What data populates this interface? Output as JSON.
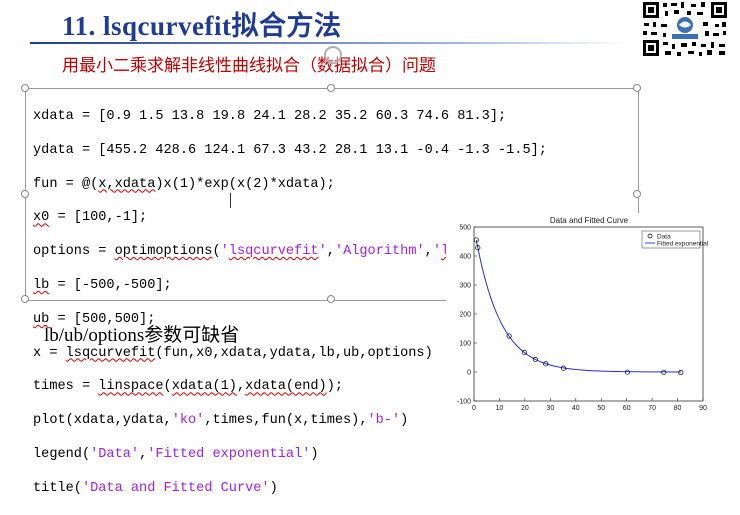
{
  "slide": {
    "title": "11. lsqcurvefit拟合方法",
    "subtitle": "用最小二乘求解非线性曲线拟合（数据拟合）问题",
    "note": "lb/ub/options参数可缺省"
  },
  "code_lines": [
    "xdata = [0.9 1.5 13.8 19.8 24.1 28.2 35.2 60.3 74.6 81.3];",
    "ydata = [455.2 428.6 124.1 67.3 43.2 28.1 13.1 -0.4 -1.3 -1.5];",
    "fun = @(x,xdata)x(1)*exp(x(2)*xdata);",
    "x0 = [100,-1];",
    "options = optimoptions('lsqcurvefit','Algorithm','levenberg-marquardt');",
    "lb = [-500,-500];",
    "ub = [500,500];",
    "x = lsqcurvefit(fun,x0,xdata,ydata,lb,ub,options)",
    "times = linspace(xdata(1),xdata(end));",
    "plot(xdata,ydata,'ko',times,fun(x,times),'b-')",
    "legend('Data','Fitted exponential')",
    "title('Data and Fitted Curve')"
  ],
  "chart_data": {
    "type": "scatter",
    "title": "Data and Fitted Curve",
    "xlim": [
      0,
      90
    ],
    "ylim": [
      -100,
      500
    ],
    "xticks": [
      0,
      10,
      20,
      30,
      40,
      50,
      60,
      70,
      80,
      90
    ],
    "yticks": [
      -100,
      0,
      100,
      200,
      300,
      400,
      500
    ],
    "grid": false,
    "legend_position": "top-right",
    "series": [
      {
        "name": "Data",
        "style": "markers",
        "color": "#000000",
        "x": [
          0.9,
          1.5,
          13.8,
          19.8,
          24.1,
          28.2,
          35.2,
          60.3,
          74.6,
          81.3
        ],
        "y": [
          455.2,
          428.6,
          124.1,
          67.3,
          43.2,
          28.1,
          13.1,
          -0.4,
          -1.3,
          -1.5
        ]
      },
      {
        "name": "Fitted exponential",
        "style": "line",
        "color": "#2b2bd6",
        "model": "a*exp(b*x)",
        "params": [
          498.8,
          -0.1013
        ]
      }
    ]
  },
  "colors": {
    "title": "#1f3b95",
    "subtitle": "#c00000",
    "code_string": "#a020f0",
    "spell_underline": "#d00000"
  }
}
